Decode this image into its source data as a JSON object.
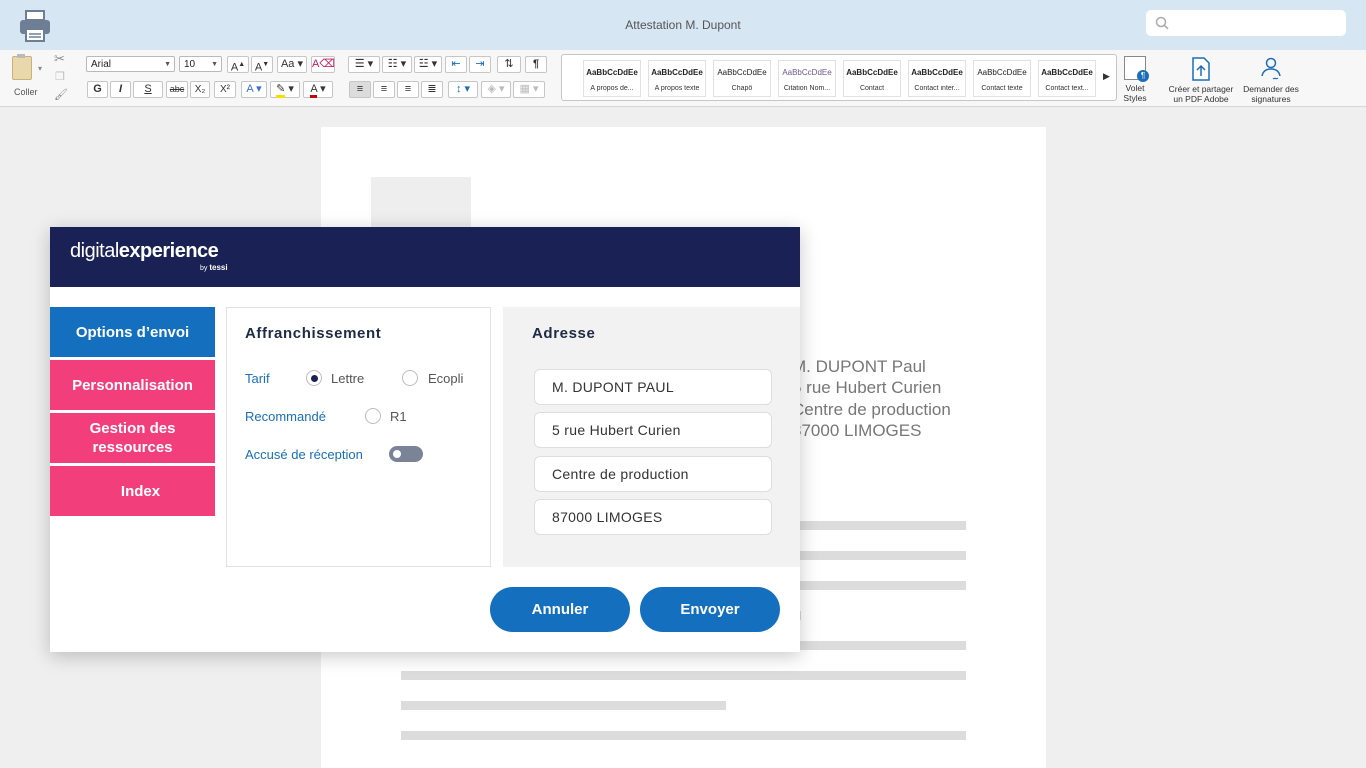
{
  "window": {
    "title": "Attestation M. Dupont",
    "search_placeholder": ""
  },
  "ribbon": {
    "paste_label": "Coller",
    "font_name": "Arial",
    "font_size": "10",
    "format_buttons": [
      "G",
      "I",
      "S",
      "abc",
      "X₂",
      "X²"
    ],
    "styles": [
      {
        "sample": "AaBbCcDdEe",
        "name": "A propos de..."
      },
      {
        "sample": "AaBbCcDdEe",
        "name": "A propos texte"
      },
      {
        "sample": "AaBbCcDdEe",
        "name": "Chapô"
      },
      {
        "sample": "AaBbCcDdEe",
        "name": "Citation Nom..."
      },
      {
        "sample": "AaBbCcDdEe",
        "name": "Contact"
      },
      {
        "sample": "AaBbCcDdEe",
        "name": "Contact inter..."
      },
      {
        "sample": "AaBbCcDdEe",
        "name": "Contact texte"
      },
      {
        "sample": "AaBbCcDdEe",
        "name": "Contact text..."
      }
    ],
    "styles_pane_label_1": "Volet",
    "styles_pane_label_2": "Styles",
    "pdf_label_1": "Créer et partager",
    "pdf_label_2": "un PDF Adobe",
    "sign_label_1": "Demander des",
    "sign_label_2": "signatures",
    "accent_colors": {
      "highlight": "#f5e100",
      "font_color": "#d00000"
    }
  },
  "document": {
    "address_lines": [
      "M. DUPONT Paul",
      "5 rue Hubert Curien",
      "Centre de production",
      "87000 LIMOGES"
    ]
  },
  "dialog": {
    "brand_light": "digital",
    "brand_bold": "experience",
    "brand_by": "by",
    "brand_tessi": "tessi",
    "nav": [
      {
        "label": "Options d’envoi",
        "color": "#1470be"
      },
      {
        "label": "Personnalisation",
        "color": "#f23f7b"
      },
      {
        "label": "Gestion des ressources",
        "color": "#f23f7b"
      },
      {
        "label": "Index",
        "color": "#f23f7b"
      }
    ],
    "postage": {
      "title": "Affranchissement",
      "tarif_label": "Tarif",
      "tarif_options": [
        "Lettre",
        "Ecopli"
      ],
      "tarif_selected": "Lettre",
      "registered_label": "Recommandé",
      "registered_option": "R1",
      "ack_label": "Accusé de réception",
      "ack_enabled": false
    },
    "address": {
      "title": "Adresse",
      "fields": [
        "M. DUPONT PAUL",
        "5 rue Hubert Curien",
        "Centre de production",
        "87000 LIMOGES"
      ]
    },
    "cancel_label": "Annuler",
    "send_label": "Envoyer"
  }
}
